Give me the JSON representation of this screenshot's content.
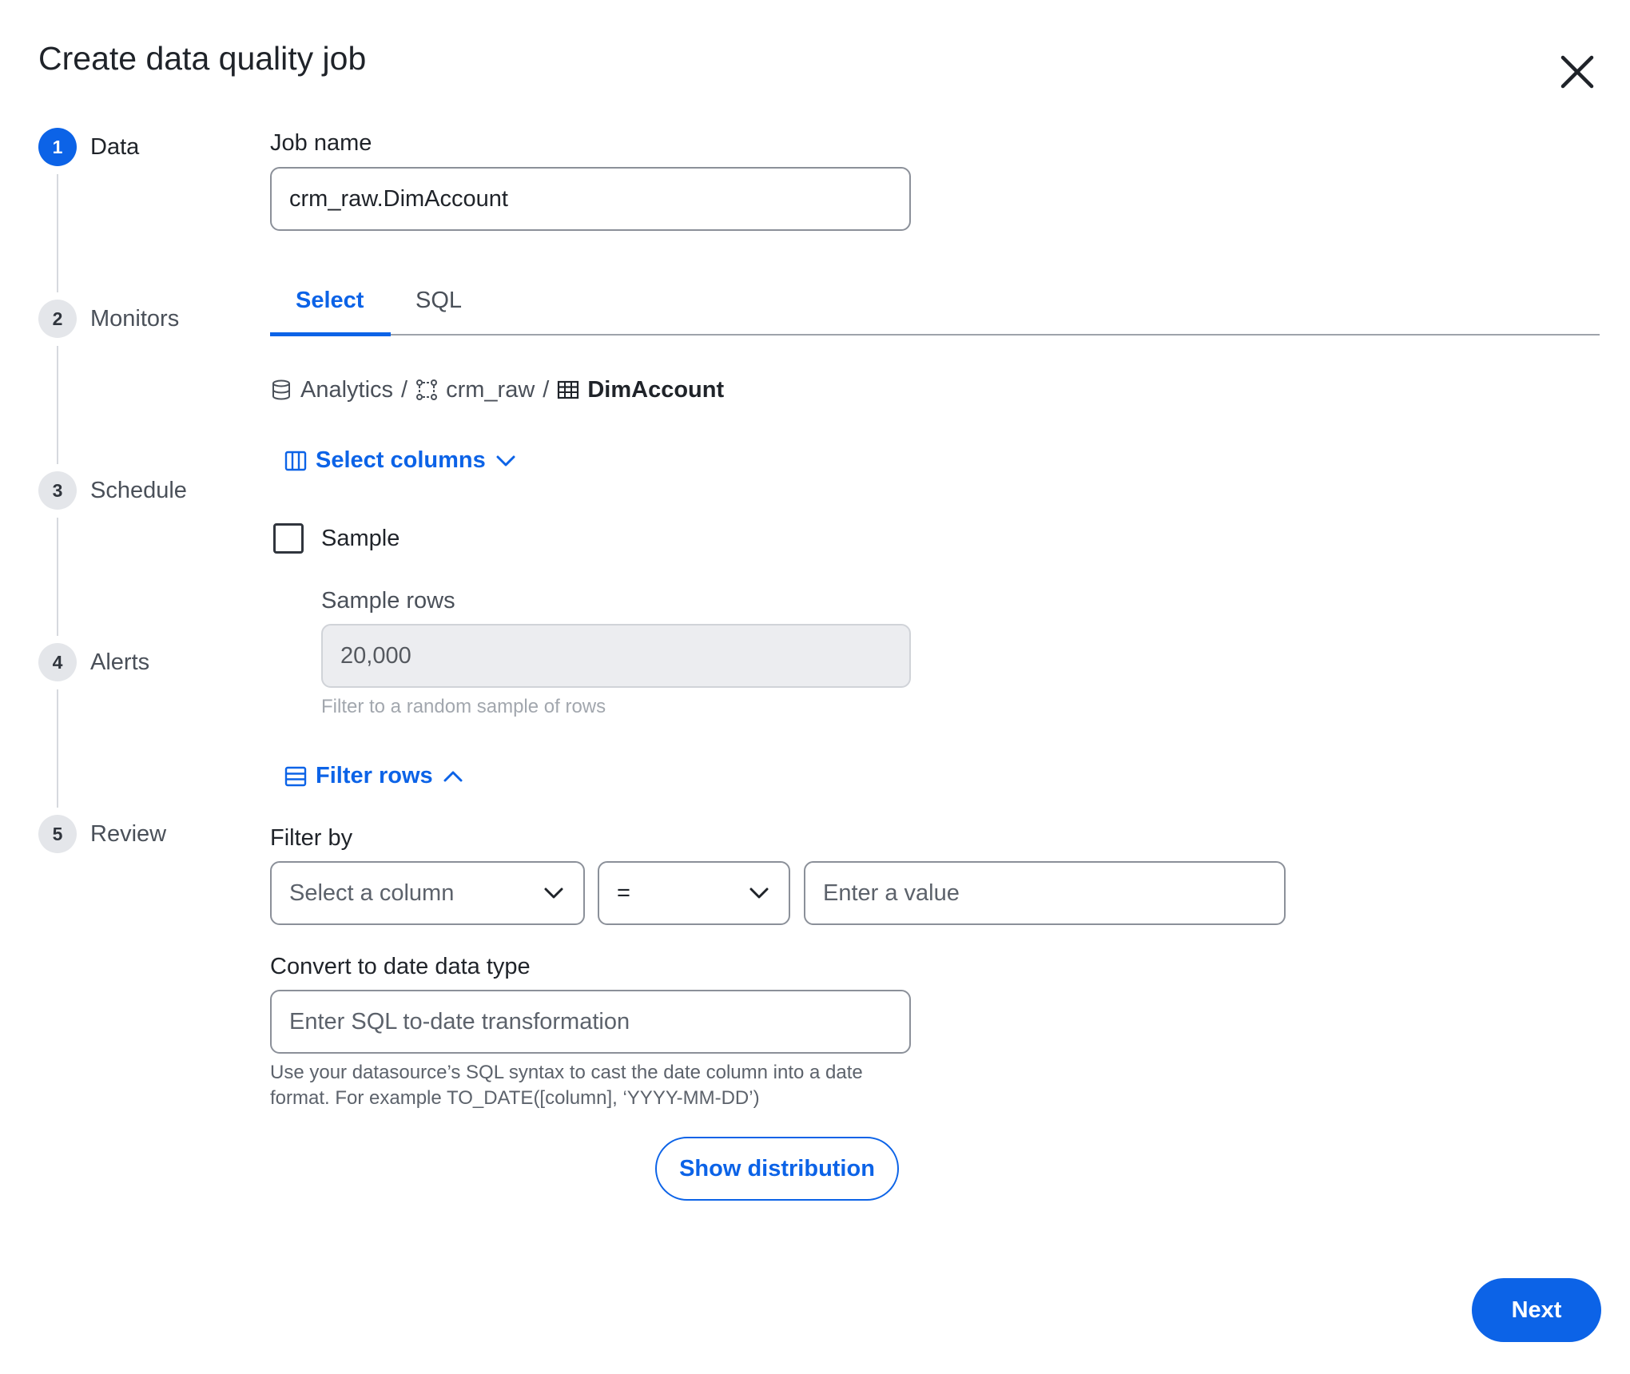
{
  "dialog": {
    "title": "Create data quality job"
  },
  "stepper": {
    "steps": [
      {
        "number": "1",
        "label": "Data",
        "active": true
      },
      {
        "number": "2",
        "label": "Monitors",
        "active": false
      },
      {
        "number": "3",
        "label": "Schedule",
        "active": false
      },
      {
        "number": "4",
        "label": "Alerts",
        "active": false
      },
      {
        "number": "5",
        "label": "Review",
        "active": false
      }
    ]
  },
  "job_name": {
    "label": "Job name",
    "value": "crm_raw.DimAccount"
  },
  "tabs": {
    "items": [
      {
        "label": "Select",
        "active": true
      },
      {
        "label": "SQL",
        "active": false
      }
    ]
  },
  "breadcrumb": {
    "database": "Analytics",
    "schema": "crm_raw",
    "table": "DimAccount",
    "separator": "/"
  },
  "select_columns": {
    "label": "Select columns"
  },
  "sample": {
    "label": "Sample",
    "checked": false,
    "rows_label": "Sample rows",
    "rows_value": "20,000",
    "rows_hint": "Filter to a random sample of rows"
  },
  "filter_rows": {
    "label": "Filter rows",
    "filter_by_label": "Filter by",
    "column_placeholder": "Select a column",
    "operator_value": "=",
    "value_placeholder": "Enter a value"
  },
  "date_conversion": {
    "label": "Convert to date data type",
    "placeholder": "Enter SQL to-date transformation",
    "hint_line1": "Use your datasource’s SQL syntax to cast the date column into a date",
    "hint_line2": "format. For example TO_DATE([column], ‘YYYY-MM-DD’)"
  },
  "actions": {
    "show_distribution": "Show distribution",
    "next": "Next"
  },
  "colors": {
    "accent": "#0c63e7",
    "text": "#1f2329",
    "muted": "#5c626b",
    "border": "#8b9099",
    "disabled_bg": "#ecedf0"
  }
}
